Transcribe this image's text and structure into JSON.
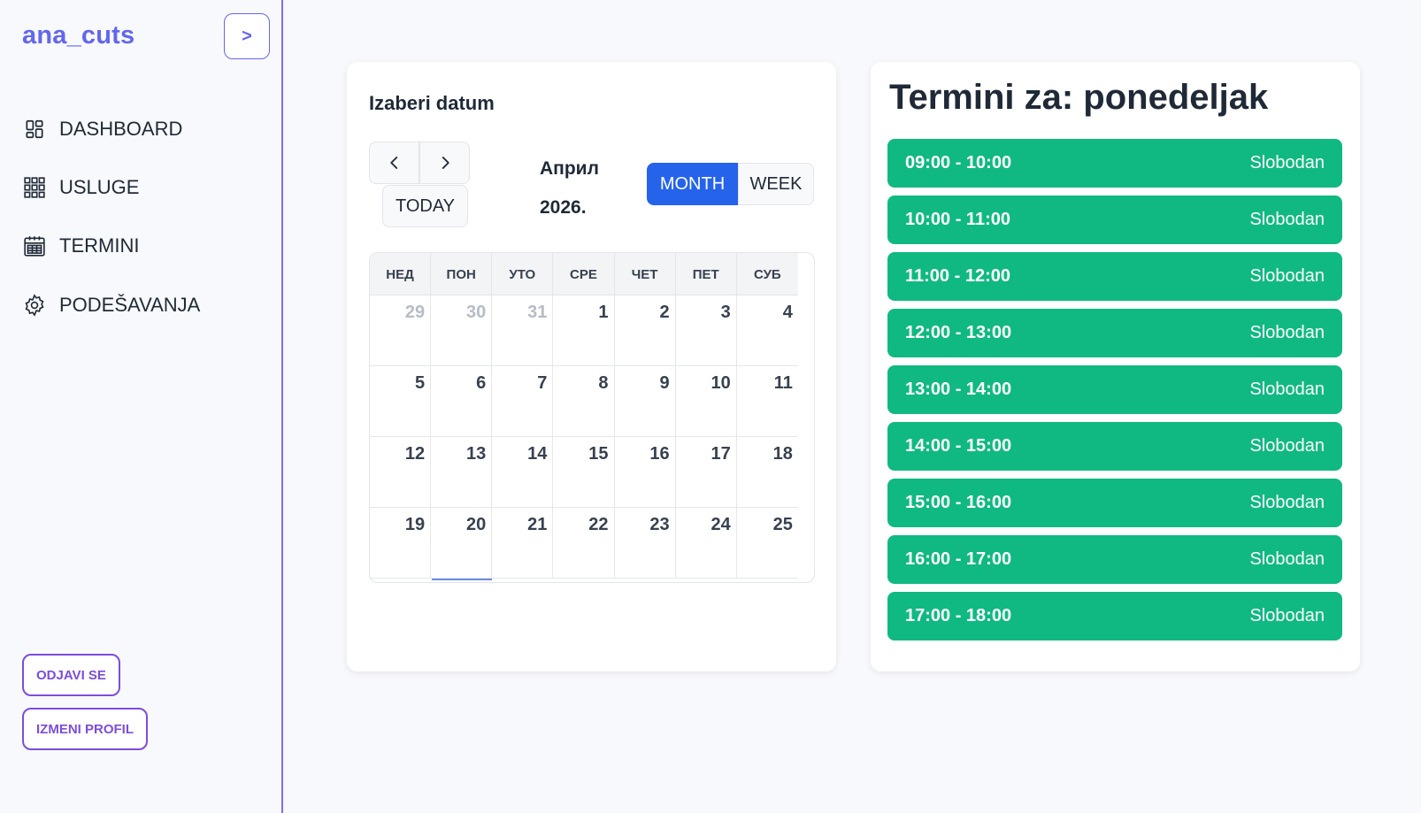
{
  "sidebar": {
    "brand": "ana_cuts",
    "toggle_label": ">",
    "items": [
      {
        "label": "DASHBOARD",
        "icon": "dashboard-icon"
      },
      {
        "label": "USLUGE",
        "icon": "grid-icon"
      },
      {
        "label": "TERMINI",
        "icon": "calendar-icon"
      },
      {
        "label": "PODEŠAVANJA",
        "icon": "gear-icon"
      }
    ],
    "logout_label": "ODJAVI SE",
    "edit_profile_label": "IZMENI PROFIL"
  },
  "calendar": {
    "title": "Izaberi datum",
    "today_label": "TODAY",
    "month_name": "Април",
    "year": "2026.",
    "view_month_label": "MONTH",
    "view_week_label": "WEEK",
    "active_view": "month",
    "weekdays": [
      "НЕД",
      "ПОН",
      "УТО",
      "СРЕ",
      "ЧЕТ",
      "ПЕТ",
      "СУБ"
    ],
    "weeks": [
      [
        {
          "d": "29",
          "other": true
        },
        {
          "d": "30",
          "other": true
        },
        {
          "d": "31",
          "other": true
        },
        {
          "d": "1"
        },
        {
          "d": "2"
        },
        {
          "d": "3"
        },
        {
          "d": "4"
        }
      ],
      [
        {
          "d": "5"
        },
        {
          "d": "6"
        },
        {
          "d": "7"
        },
        {
          "d": "8"
        },
        {
          "d": "9"
        },
        {
          "d": "10"
        },
        {
          "d": "11"
        }
      ],
      [
        {
          "d": "12"
        },
        {
          "d": "13"
        },
        {
          "d": "14"
        },
        {
          "d": "15"
        },
        {
          "d": "16"
        },
        {
          "d": "17"
        },
        {
          "d": "18"
        }
      ],
      [
        {
          "d": "19"
        },
        {
          "d": "20"
        },
        {
          "d": "21"
        },
        {
          "d": "22"
        },
        {
          "d": "23"
        },
        {
          "d": "24"
        },
        {
          "d": "25"
        }
      ]
    ]
  },
  "slots": {
    "title": "Termini za: ponedeljak",
    "items": [
      {
        "time": "09:00 - 10:00",
        "status": "Slobodan"
      },
      {
        "time": "10:00 - 11:00",
        "status": "Slobodan"
      },
      {
        "time": "11:00 - 12:00",
        "status": "Slobodan"
      },
      {
        "time": "12:00 - 13:00",
        "status": "Slobodan"
      },
      {
        "time": "13:00 - 14:00",
        "status": "Slobodan"
      },
      {
        "time": "14:00 - 15:00",
        "status": "Slobodan"
      },
      {
        "time": "15:00 - 16:00",
        "status": "Slobodan"
      },
      {
        "time": "16:00 - 17:00",
        "status": "Slobodan"
      },
      {
        "time": "17:00 - 18:00",
        "status": "Slobodan"
      }
    ]
  },
  "colors": {
    "brand": "#6366f1",
    "accent_blue": "#2563eb",
    "slot_green": "#10b981",
    "outline_purple": "#7c4ddb"
  }
}
